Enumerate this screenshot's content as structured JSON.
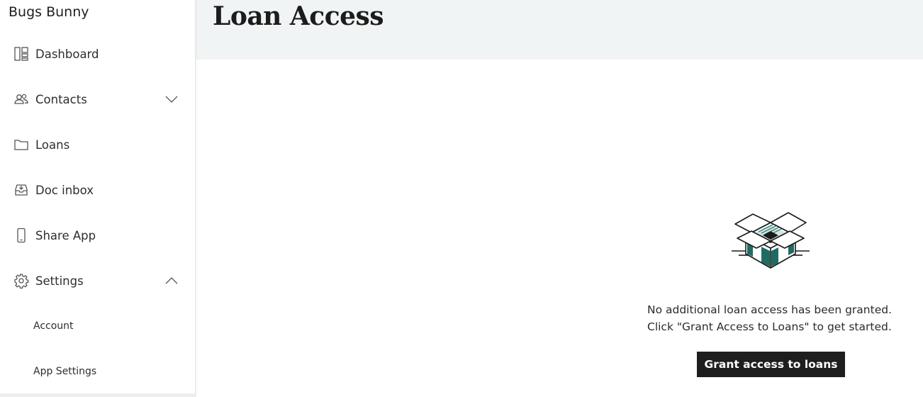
{
  "sidebar": {
    "user_name": "Bugs Bunny",
    "items": [
      {
        "label": "Dashboard",
        "icon": "dashboard-icon"
      },
      {
        "label": "Contacts",
        "icon": "contacts-icon",
        "expandable": true,
        "expanded": false
      },
      {
        "label": "Loans",
        "icon": "folder-icon"
      },
      {
        "label": "Doc inbox",
        "icon": "inbox-icon"
      },
      {
        "label": "Share App",
        "icon": "phone-icon"
      },
      {
        "label": "Settings",
        "icon": "gear-icon",
        "expandable": true,
        "expanded": true
      }
    ],
    "settings_subitems": [
      {
        "label": "Account"
      },
      {
        "label": "App Settings"
      }
    ]
  },
  "header": {
    "title": "Loan Access"
  },
  "empty_state": {
    "illustration": "open-box-icon",
    "line1": "No additional loan access has been granted.",
    "line2": "Click \"Grant Access to Loans\" to get started.",
    "button_label": "Grant access to loans"
  },
  "colors": {
    "header_bg": "#f1f4f4",
    "button_bg": "#1e1e1e",
    "accent_teal": "#1f6b63"
  }
}
